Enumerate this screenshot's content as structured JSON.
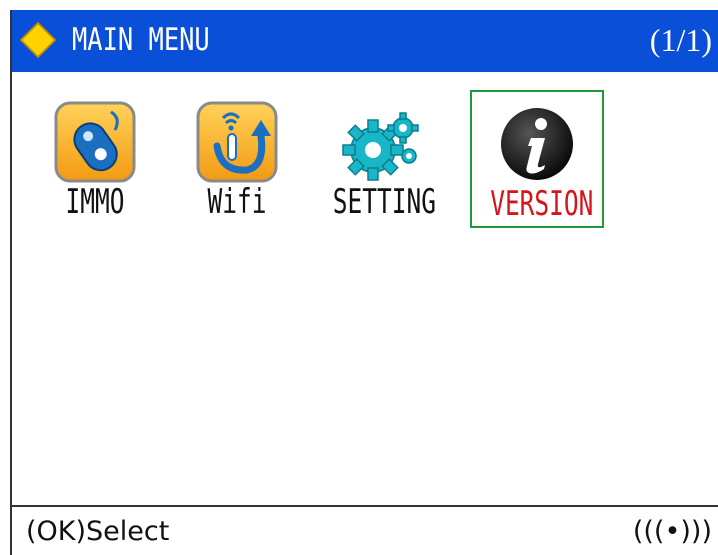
{
  "header": {
    "title": "MAIN MENU",
    "page_indicator": "(1/1)",
    "icon": "diamond-logo-icon",
    "bar_color": "#0a4fd8"
  },
  "menu": {
    "items": [
      {
        "label": "IMMO",
        "icon": "car-key-icon",
        "selected": false
      },
      {
        "label": "Wifi",
        "icon": "wifi-update-icon",
        "selected": false
      },
      {
        "label": "SETTING",
        "icon": "gears-icon",
        "selected": false
      },
      {
        "label": "VERSION",
        "icon": "info-icon",
        "selected": true
      }
    ],
    "selected_color": "#d6151b",
    "selection_border_color": "#1f9a3a"
  },
  "status": {
    "hint": "(OK)Select",
    "signal": "(((•)))"
  }
}
